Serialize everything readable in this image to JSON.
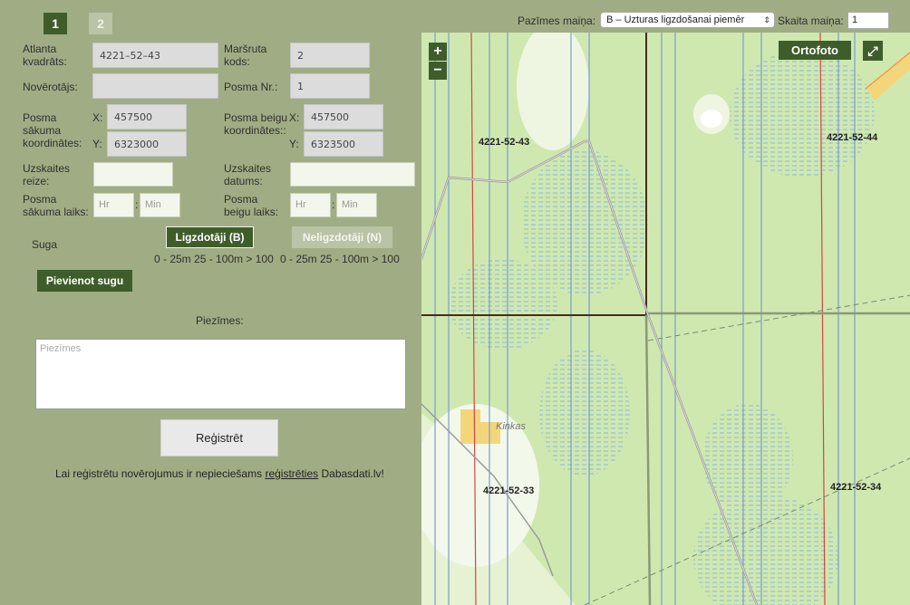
{
  "tabs": [
    "1",
    "2"
  ],
  "toolbar": {
    "symbol_label": "Pazīmes maiņa:",
    "symbol_value": "B – Uzturas ligzdošanai piemēr",
    "count_label": "Skaita maiņa:",
    "count_value": "1"
  },
  "form": {
    "atlas_label": "Atlanta kvadrāts:",
    "atlas_value": "4221–52–43",
    "route_label": "Maršruta kods:",
    "route_value": "2",
    "observer_label": "Novērotājs:",
    "observer_value": "",
    "section_label": "Posma Nr.:",
    "section_value": "1",
    "start_coord_label": "Posma sākuma koordinātes:",
    "end_coord_label": "Posma beigu koordinātes::",
    "x_label": "X:",
    "y_label": "Y:",
    "start_x": "457500",
    "start_y": "6323000",
    "end_x": "457500",
    "end_y": "6323500",
    "count_time_label": "Uzskaites reize:",
    "count_time_value": "",
    "count_date_label": "Uzskaites datums:",
    "count_date_value": "",
    "start_time_label": "Posma sākuma laiks:",
    "end_time_label": "Posma beigu laiks:",
    "hour_placeholder": "Hr",
    "minute_placeholder": "Min",
    "time_separator": ":"
  },
  "species": {
    "label": "Suga",
    "nesting_button": "Ligzdotāji (B)",
    "non_nesting_button": "Neligzdotāji (N)",
    "nesting_ranges": "0 - 25m 25 - 100m > 100",
    "non_nesting_ranges": "0 - 25m 25 - 100m > 100",
    "add_species_button": "Pievienot sugu"
  },
  "notes": {
    "label": "Piezīmes:",
    "placeholder": "Piezīmes"
  },
  "register": {
    "button": "Reģistrēt",
    "message_before": "Lai reģistrētu novērojumus ir nepieciešams ",
    "message_link": "reģistrēties",
    "message_after": " Dabasdati.lv!"
  },
  "map": {
    "zoom_in": "+",
    "zoom_out": "−",
    "ortho_button": "Ortofoto",
    "grid_labels": [
      "4221-52-43",
      "4221-52-44",
      "4221-52-33",
      "4221-52-34"
    ],
    "place_label": "Kinkas",
    "colors": {
      "background": "#e6f2d2",
      "forest": "#c9e6a8",
      "wetland_hatch": "#8fb9dc",
      "grid_line": "#4a2a1a",
      "road_red": "#d64545",
      "survey_line": "#7d9bd0"
    }
  },
  "icons": {
    "fullscreen": "expand-icon",
    "dropdown": "chevron-down-icon"
  }
}
